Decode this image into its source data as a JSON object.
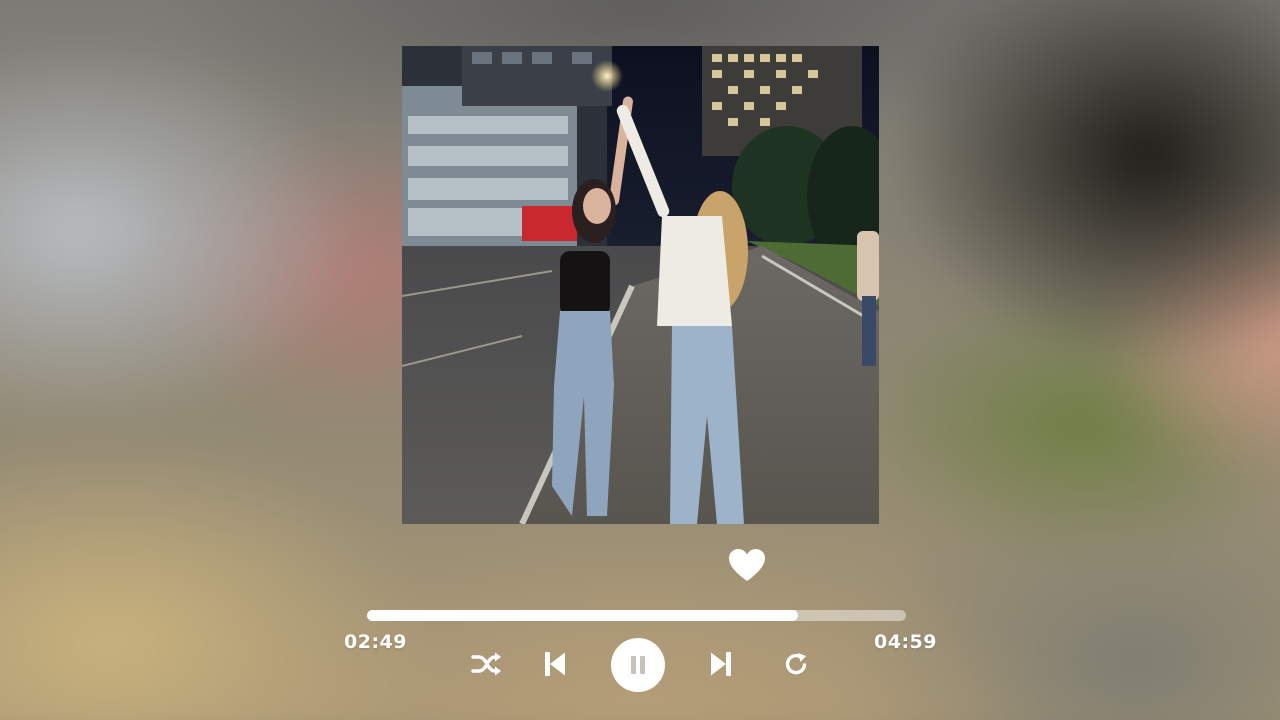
{
  "player": {
    "elapsed": "02:49",
    "total": "04:59",
    "progress_fraction": 0.8,
    "liked": true
  },
  "icons": {
    "like": "heart-icon",
    "shuffle": "shuffle-icon",
    "previous": "skip-previous-icon",
    "play_pause": "pause-icon",
    "next": "skip-next-icon",
    "repeat": "repeat-icon"
  },
  "colors": {
    "controls": "#ffffff",
    "progress_track": "rgba(255,255,255,0.45)",
    "pause_glyph": "#c8c3b8"
  }
}
